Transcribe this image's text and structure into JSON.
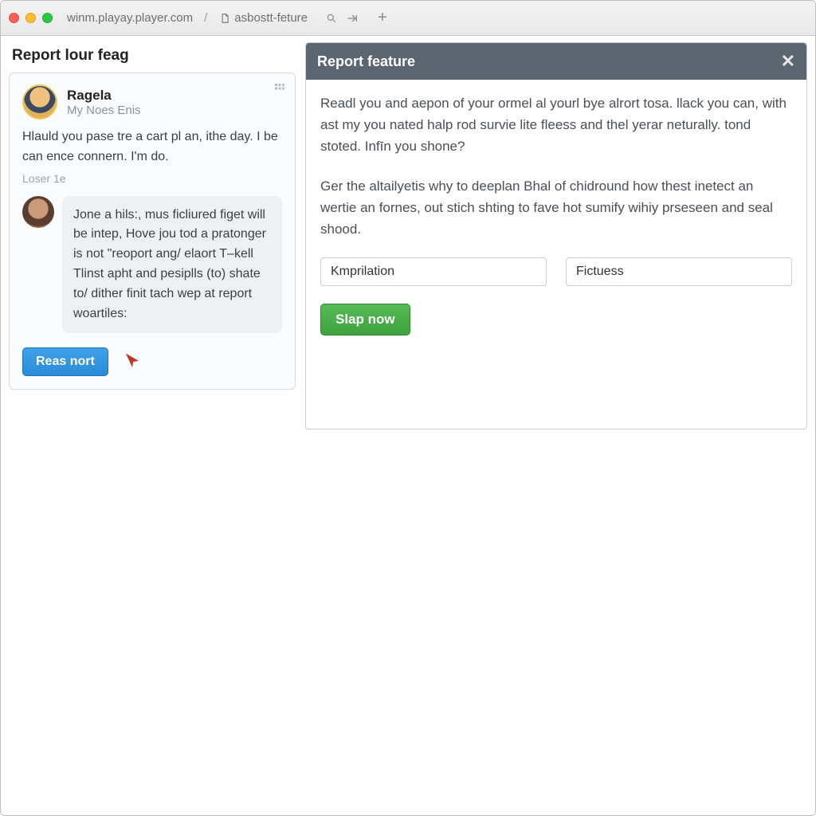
{
  "chrome": {
    "url": "winm.playay.player.com",
    "sep": "/",
    "doc_icon": "doc-icon",
    "doc_name": "asbostt-feture"
  },
  "sidebar": {
    "title": "Report lour feag",
    "user": {
      "name": "Ragela",
      "sub": "My Noes Enis"
    },
    "intro": "Hlauld you pase tre a cart pl an, ithe day. I be can ence connern. I'm do.",
    "loser": "Loser 1e",
    "message": "Jone a hils:, mus ficliured figet will be intep, Hove jou tod a pratonger is not \"reoport ang/ elaort T–kell Tlinst apht and pesiplls (to) shate to/ dither finit tach wep at report woartiles:",
    "button": "Reas nort"
  },
  "panel": {
    "title": "Report feature",
    "p1": "Readl you and aepon of your ormel al yourl bye alrort tosa. llack you can, with ast my you nated halp rod survie lite fleess and thel yerar neturally. tond stoted. Infīn you shone?",
    "p2": "Ger the altailyetis why to deeplan Bhal of chidround how thest inetect an wertie an fornes, out stich shting to fave hot sumify wihiy prseseen and seal shood.",
    "input1_value": "Kmprilation",
    "input2_value": "Fictuess",
    "submit": "Slap now"
  }
}
